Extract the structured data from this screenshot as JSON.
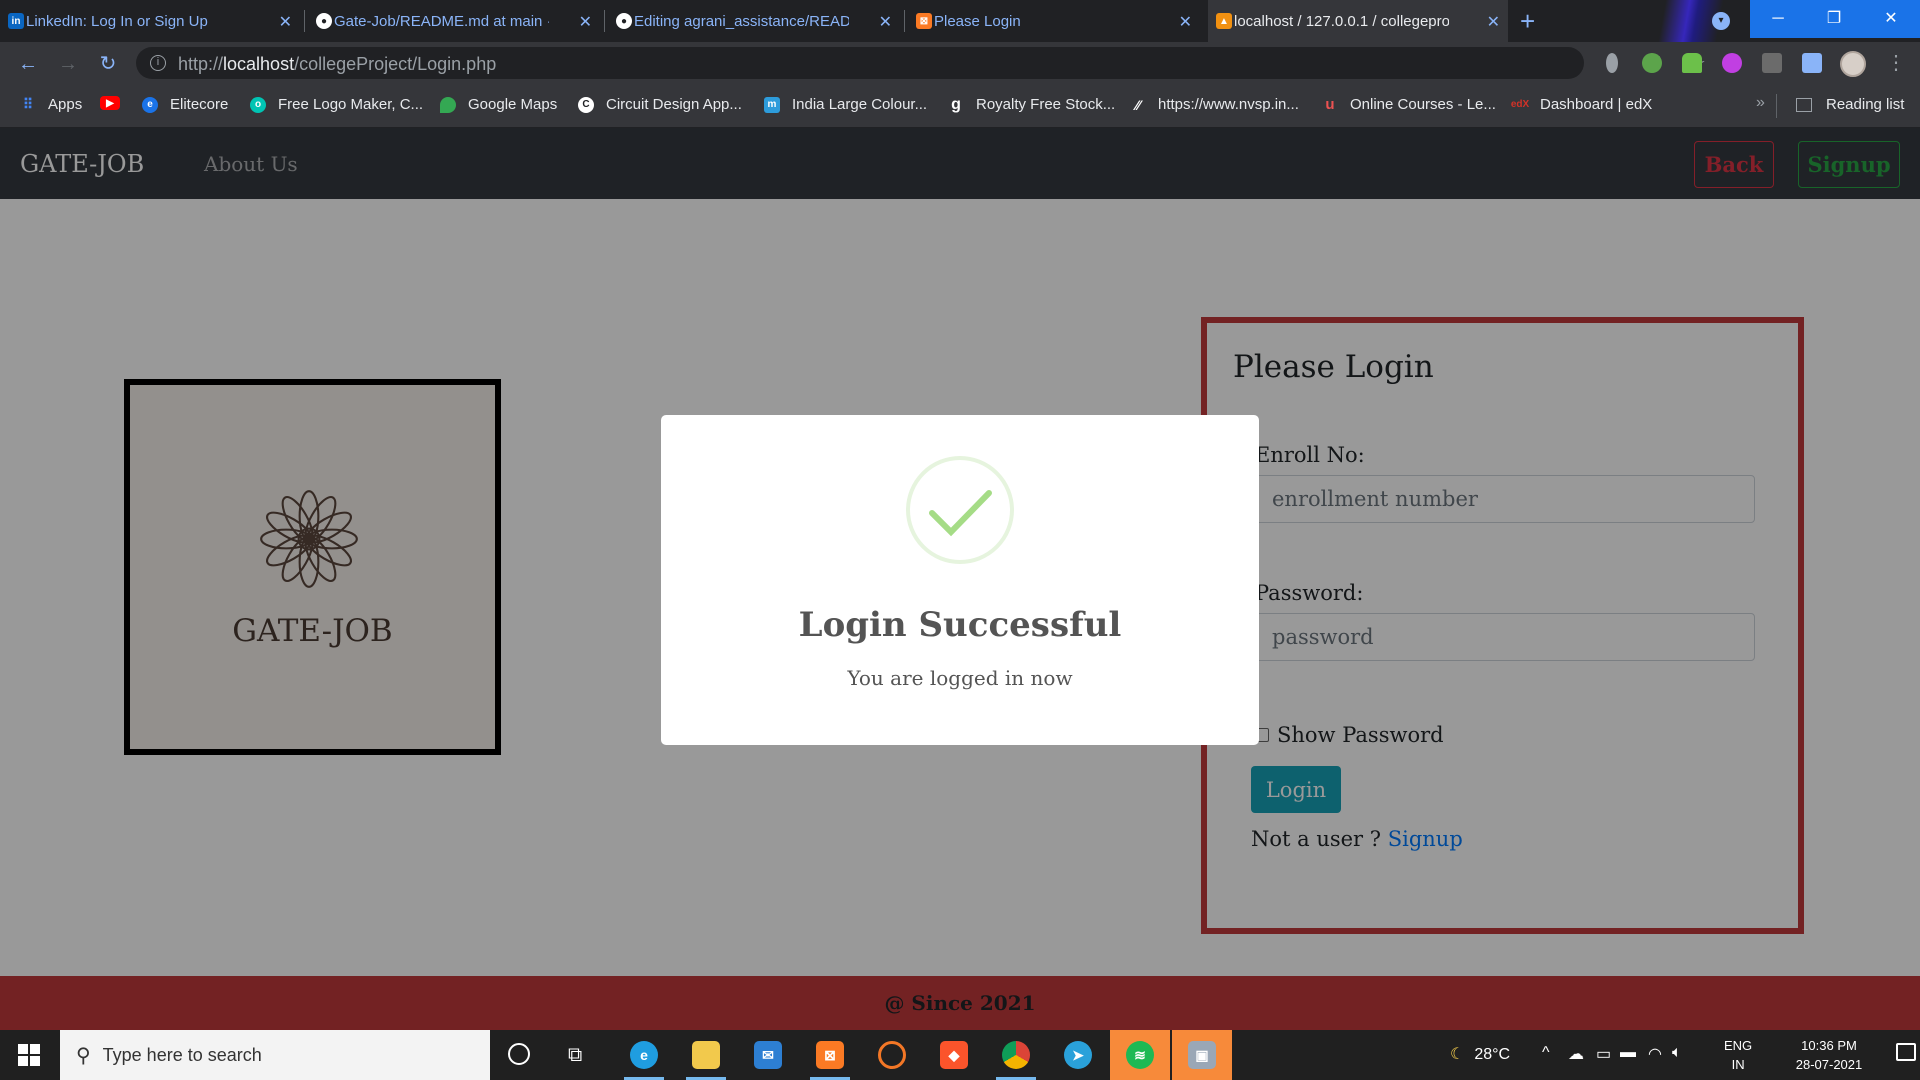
{
  "browser": {
    "tabs": [
      {
        "title": "LinkedIn: Log In or Sign Up",
        "icon": "linkedin-icon",
        "color": "#0a66c2",
        "glyph": "in"
      },
      {
        "title": "Gate-Job/README.md at main · I",
        "icon": "github-icon",
        "color": "#ffffff",
        "glyph": "●"
      },
      {
        "title": "Editing agrani_assistance/READM",
        "icon": "github-icon",
        "color": "#ffffff",
        "glyph": "●"
      },
      {
        "title": "Please Login",
        "icon": "xampp-icon",
        "color": "#fb7a24",
        "glyph": "⊠"
      },
      {
        "title": "localhost / 127.0.0.1 / collegepro",
        "icon": "phpmyadmin-icon",
        "color": "#f29111",
        "glyph": "▲"
      }
    ],
    "close_glyph": "✕",
    "new_tab_glyph": "+",
    "window_controls": {
      "minimize": "─",
      "restore": "❐",
      "close": "✕"
    },
    "url_host": "localhost",
    "url_prefix": "http://",
    "url_path": "/collegeProject/Login.php",
    "bookmarks": [
      {
        "label": "Apps",
        "icon": "apps-grid-icon",
        "color": "#4285f4"
      },
      {
        "label": "",
        "icon": "youtube-icon",
        "color": "#ff0000"
      },
      {
        "label": "Elitecore",
        "icon": "elitecore-icon",
        "color": "#1a73e8"
      },
      {
        "label": "Free Logo Maker, C...",
        "icon": "logo-maker-icon",
        "color": "#00c4b3"
      },
      {
        "label": "Google Maps",
        "icon": "maps-pin-icon",
        "color": "#34a853"
      },
      {
        "label": "Circuit Design App...",
        "icon": "circuit-icon",
        "color": "#ffffff"
      },
      {
        "label": "India Large Colour...",
        "icon": "m-icon",
        "color": "#2d9cdb"
      },
      {
        "label": "Royalty Free Stock...",
        "icon": "g-icon",
        "color": "#ffffff"
      },
      {
        "label": "https://www.nvsp.in...",
        "icon": "nvsp-icon",
        "color": "#ffffff"
      },
      {
        "label": "Online Courses - Le...",
        "icon": "udemy-icon",
        "color": "#ec5252"
      },
      {
        "label": "Dashboard | edX",
        "icon": "edx-icon",
        "color": "#d23228"
      }
    ],
    "more_glyph": "»",
    "reading_list": "Reading list"
  },
  "site": {
    "brand": "GATE-JOB",
    "about": "About Us",
    "back": "Back",
    "signup": "Signup",
    "logo_text": "GATE-JOB",
    "login": {
      "title": "Please Login",
      "enroll_label": "Enroll No:",
      "enroll_placeholder": "enrollment number",
      "password_label": "Password:",
      "password_placeholder": "password",
      "show_password": "Show Password",
      "login_button": "Login",
      "not_user": "Not a user ?",
      "signup_link": "Signup"
    },
    "footer": "@ Since 2021"
  },
  "modal": {
    "title": "Login Successful",
    "text": "You are logged in now"
  },
  "taskbar": {
    "search_placeholder": "Type here to search",
    "apps": [
      {
        "name": "edge-icon",
        "color": "#1f9de0",
        "glyph": "e"
      },
      {
        "name": "file-explorer-icon",
        "color": "#f2c94c",
        "glyph": "▬"
      },
      {
        "name": "mail-icon",
        "color": "#2d7fd3",
        "glyph": "✉"
      },
      {
        "name": "xampp-icon",
        "color": "#fb7a24",
        "glyph": "⊠"
      },
      {
        "name": "jupyter-icon",
        "color": "#202020",
        "glyph": "◌"
      },
      {
        "name": "brave-icon",
        "color": "#fb542b",
        "glyph": "◆"
      },
      {
        "name": "chrome-icon",
        "color": "#db4437",
        "glyph": "◉"
      },
      {
        "name": "telegram-icon",
        "color": "#2aa1da",
        "glyph": "➤"
      },
      {
        "name": "spotify-icon",
        "color": "#1db954",
        "glyph": "≋"
      },
      {
        "name": "files-app-icon",
        "color": "#9aa7b6",
        "glyph": "▣"
      }
    ],
    "temperature": "28°C",
    "lang_top": "ENG",
    "lang_bottom": "IN",
    "time": "10:36 PM",
    "date": "28-07-2021"
  }
}
